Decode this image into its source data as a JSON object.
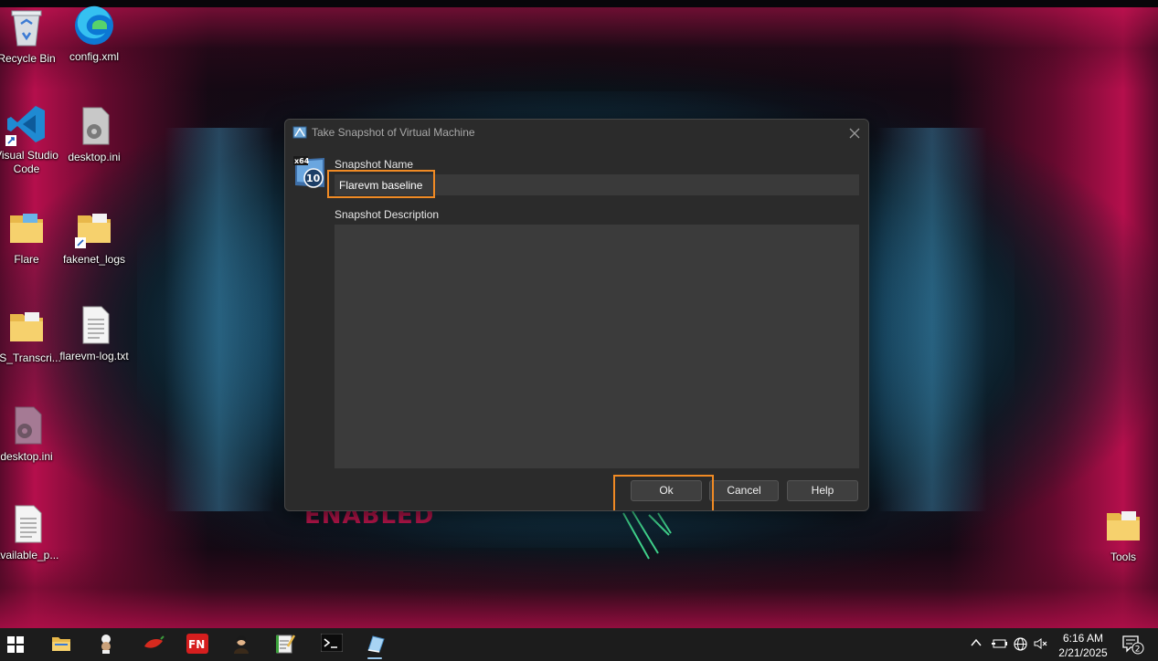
{
  "desktop": {
    "icons": [
      {
        "label": "Recycle Bin"
      },
      {
        "label": "config.xml"
      },
      {
        "label": "Visual Studio Code"
      },
      {
        "label": "desktop.ini"
      },
      {
        "label": "Flare"
      },
      {
        "label": "fakenet_logs"
      },
      {
        "label": "PS_Transcri..."
      },
      {
        "label": "flarevm-log.txt"
      },
      {
        "label": "desktop.ini"
      },
      {
        "label": "available_p..."
      },
      {
        "label": "Tools"
      }
    ],
    "wallpaper_text": "ENABLED"
  },
  "dialog": {
    "title": "Take Snapshot of Virtual Machine",
    "name_label": "Snapshot Name",
    "name_value": "Flarevm baseline",
    "description_label": "Snapshot Description",
    "description_value": "",
    "buttons": {
      "ok": "Ok",
      "cancel": "Cancel",
      "help": "Help"
    },
    "icon_badge_top": "x64",
    "icon_badge_number": "10",
    "highlight_color": "#f08a24"
  },
  "taskbar": {
    "apps": [
      "start-icon",
      "file-explorer-icon",
      "chef-icon",
      "pepper-icon",
      "fn-icon",
      "portrait-icon",
      "notepad-icon",
      "terminal-icon",
      "virtualbox-icon"
    ],
    "fn_badge": "FN",
    "time": "6:16 AM",
    "date": "2/21/2025",
    "notification_count": "2"
  }
}
